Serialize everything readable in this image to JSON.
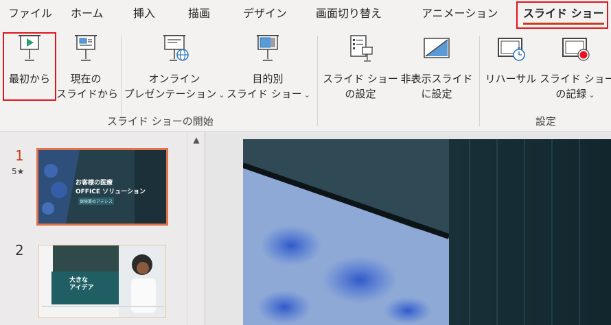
{
  "tabs": [
    {
      "label": "ファイル"
    },
    {
      "label": "ホーム"
    },
    {
      "label": "挿入"
    },
    {
      "label": "描画"
    },
    {
      "label": "デザイン"
    },
    {
      "label": "画面切り替え"
    },
    {
      "label": "アニメーション"
    },
    {
      "label": "スライド ショー"
    }
  ],
  "ribbon": {
    "start_group": {
      "label": "スライド ショーの開始",
      "buttons": [
        {
          "line1": "最初から",
          "line2": ""
        },
        {
          "line1": "現在の",
          "line2": "スライドから"
        },
        {
          "line1": "オンライン",
          "line2": "プレゼンテーション"
        },
        {
          "line1": "目的別",
          "line2": "スライド ショー"
        }
      ]
    },
    "setup_group": {
      "label": "設定",
      "buttons": [
        {
          "line1": "スライド ショー",
          "line2": "の設定"
        },
        {
          "line1": "非表示スライド",
          "line2": "に設定"
        },
        {
          "line1": "リハーサル",
          "line2": ""
        },
        {
          "line1": "スライド ショー",
          "line2": "の記録"
        }
      ]
    },
    "dropdown_glyph": "⌄"
  },
  "thumbnails": [
    {
      "number": "1",
      "has_animation_star": true,
      "title_line1": "お客様の医療",
      "title_line2": "OFFICE ソリューション",
      "subtitle": "保険業のアテシス"
    },
    {
      "number": "2",
      "has_animation_star": false,
      "title_line1": "大きな",
      "title_line2": "アイデア"
    }
  ],
  "colors": {
    "accent": "#c43e1c",
    "highlight": "#e0141e"
  }
}
